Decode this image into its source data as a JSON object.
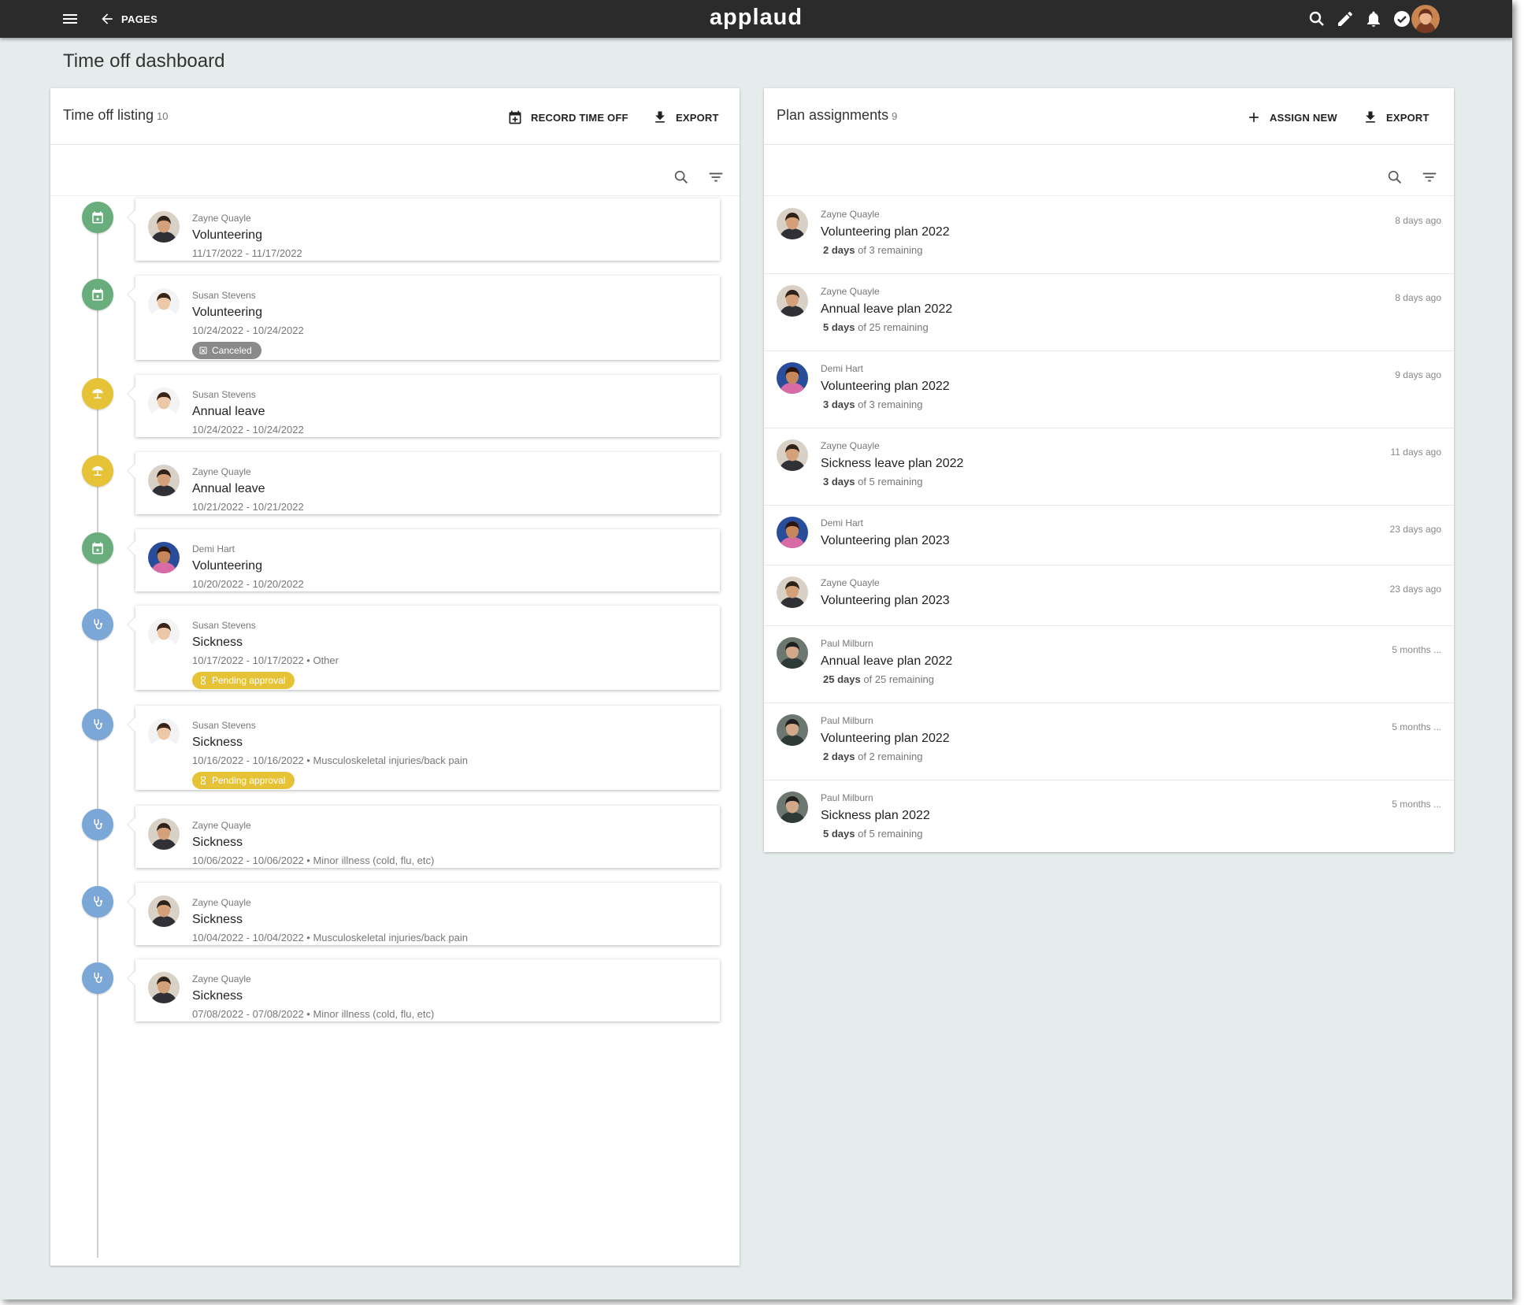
{
  "brand": "applaud",
  "nav": {
    "back_label": "PAGES"
  },
  "page_title": "Time off dashboard",
  "colors": {
    "topbar": "#2b2b2b",
    "background": "#e5ecec",
    "volunteering": "#6aad7c",
    "annual_leave": "#e5c236",
    "sickness": "#7aa7d6",
    "pending": "#e5c236",
    "canceled": "#8a8a8a"
  },
  "left": {
    "title": "Time off listing",
    "count": "10",
    "record_label": "RECORD TIME OFF",
    "export_label": "EXPORT",
    "items": [
      {
        "name": "Zayne Quayle",
        "type": "Volunteering",
        "dates": "11/17/2022 - 11/17/2022",
        "badge": "",
        "kind": "volunteering",
        "person": "zayne"
      },
      {
        "name": "Susan Stevens",
        "type": "Volunteering",
        "dates": "10/24/2022 - 10/24/2022",
        "badge": "Canceled",
        "kind": "volunteering",
        "person": "susan"
      },
      {
        "name": "Susan Stevens",
        "type": "Annual leave",
        "dates": "10/24/2022 - 10/24/2022",
        "badge": "",
        "kind": "annual",
        "person": "susan"
      },
      {
        "name": "Zayne Quayle",
        "type": "Annual leave",
        "dates": "10/21/2022 - 10/21/2022",
        "badge": "",
        "kind": "annual",
        "person": "zayne"
      },
      {
        "name": "Demi Hart",
        "type": "Volunteering",
        "dates": "10/20/2022 - 10/20/2022",
        "badge": "",
        "kind": "volunteering",
        "person": "demi"
      },
      {
        "name": "Susan Stevens",
        "type": "Sickness",
        "dates": "10/17/2022 - 10/17/2022 • Other",
        "badge": "Pending approval",
        "kind": "sickness",
        "person": "susan"
      },
      {
        "name": "Susan Stevens",
        "type": "Sickness",
        "dates": "10/16/2022 - 10/16/2022 • Musculoskeletal injuries/back pain",
        "badge": "Pending approval",
        "kind": "sickness",
        "person": "susan"
      },
      {
        "name": "Zayne Quayle",
        "type": "Sickness",
        "dates": "10/06/2022 - 10/06/2022 • Minor illness (cold, flu, etc)",
        "badge": "",
        "kind": "sickness",
        "person": "zayne"
      },
      {
        "name": "Zayne Quayle",
        "type": "Sickness",
        "dates": "10/04/2022 - 10/04/2022 • Musculoskeletal injuries/back pain",
        "badge": "",
        "kind": "sickness",
        "person": "zayne"
      },
      {
        "name": "Zayne Quayle",
        "type": "Sickness",
        "dates": "07/08/2022 - 07/08/2022 • Minor illness (cold, flu, etc)",
        "badge": "",
        "kind": "sickness",
        "person": "zayne"
      }
    ]
  },
  "right": {
    "title": "Plan assignments",
    "count": "9",
    "assign_label": "ASSIGN NEW",
    "export_label": "EXPORT",
    "items": [
      {
        "name": "Zayne Quayle",
        "plan": "Volunteering plan 2022",
        "days": "2 days",
        "rest": "of 3 remaining",
        "time": "8 days ago",
        "person": "zayne"
      },
      {
        "name": "Zayne Quayle",
        "plan": "Annual leave plan 2022",
        "days": "5 days",
        "rest": "of 25 remaining",
        "time": "8 days ago",
        "person": "zayne"
      },
      {
        "name": "Demi Hart",
        "plan": "Volunteering plan 2022",
        "days": "3 days",
        "rest": "of 3 remaining",
        "time": "9 days ago",
        "person": "demi"
      },
      {
        "name": "Zayne Quayle",
        "plan": "Sickness leave plan 2022",
        "days": "3 days",
        "rest": "of 5 remaining",
        "time": "11 days ago",
        "person": "zayne"
      },
      {
        "name": "Demi Hart",
        "plan": "Volunteering plan 2023",
        "days": "",
        "rest": "",
        "time": "23 days ago",
        "person": "demi"
      },
      {
        "name": "Zayne Quayle",
        "plan": "Volunteering plan 2023",
        "days": "",
        "rest": "",
        "time": "23 days ago",
        "person": "zayne"
      },
      {
        "name": "Paul Milburn",
        "plan": "Annual leave plan 2022",
        "days": "25 days",
        "rest": "of 25 remaining",
        "time": "5 months ...",
        "person": "paul"
      },
      {
        "name": "Paul Milburn",
        "plan": "Volunteering plan 2022",
        "days": "2 days",
        "rest": "of 2 remaining",
        "time": "5 months ...",
        "person": "paul"
      },
      {
        "name": "Paul Milburn",
        "plan": "Sickness plan 2022",
        "days": "5 days",
        "rest": "of 5 remaining",
        "time": "5 months ...",
        "person": "paul"
      }
    ]
  }
}
